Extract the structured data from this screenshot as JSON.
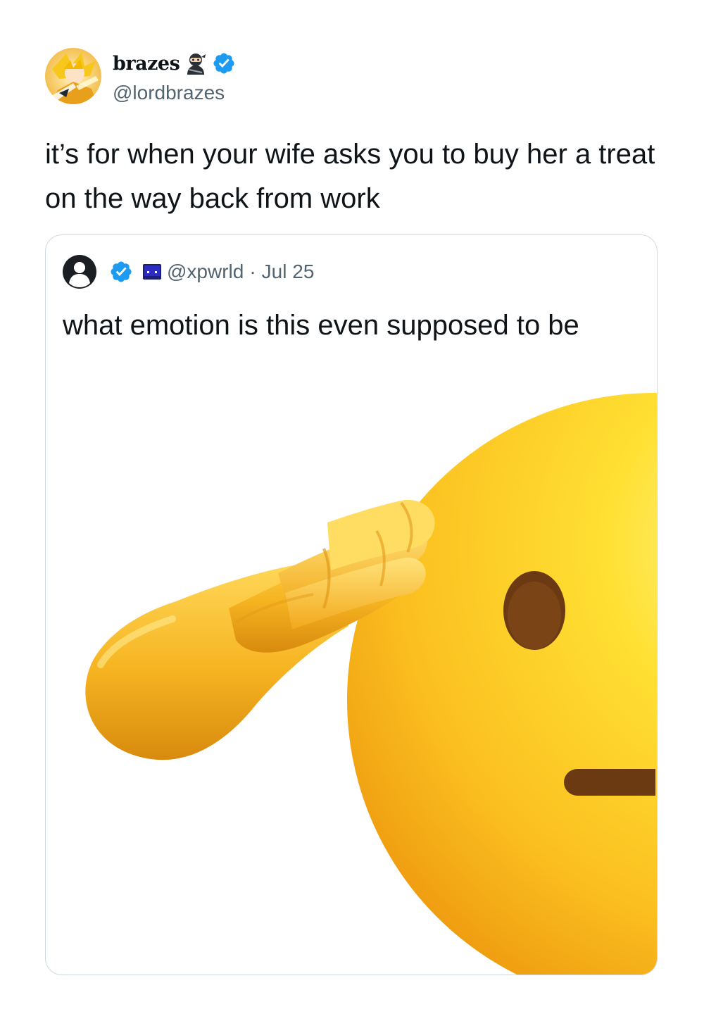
{
  "tweet": {
    "display_name": "brazes",
    "handle": "@lordbrazes",
    "text": "it’s for when your wife asks you to buy her a treat on the way back from work",
    "name_emoji_icon": "ninja-icon",
    "verified_icon": "verified-badge-icon"
  },
  "quoted_tweet": {
    "handle": "@xpwrld",
    "separator": "·",
    "date": "Jul 25",
    "text": "what emotion is this even supposed to be",
    "media_icon": "saluting-face-emoji"
  },
  "colors": {
    "verified_blue": "#1d9bf0",
    "secondary_text": "#536471",
    "primary_text": "#0f1419",
    "card_border": "#cfd9de"
  }
}
